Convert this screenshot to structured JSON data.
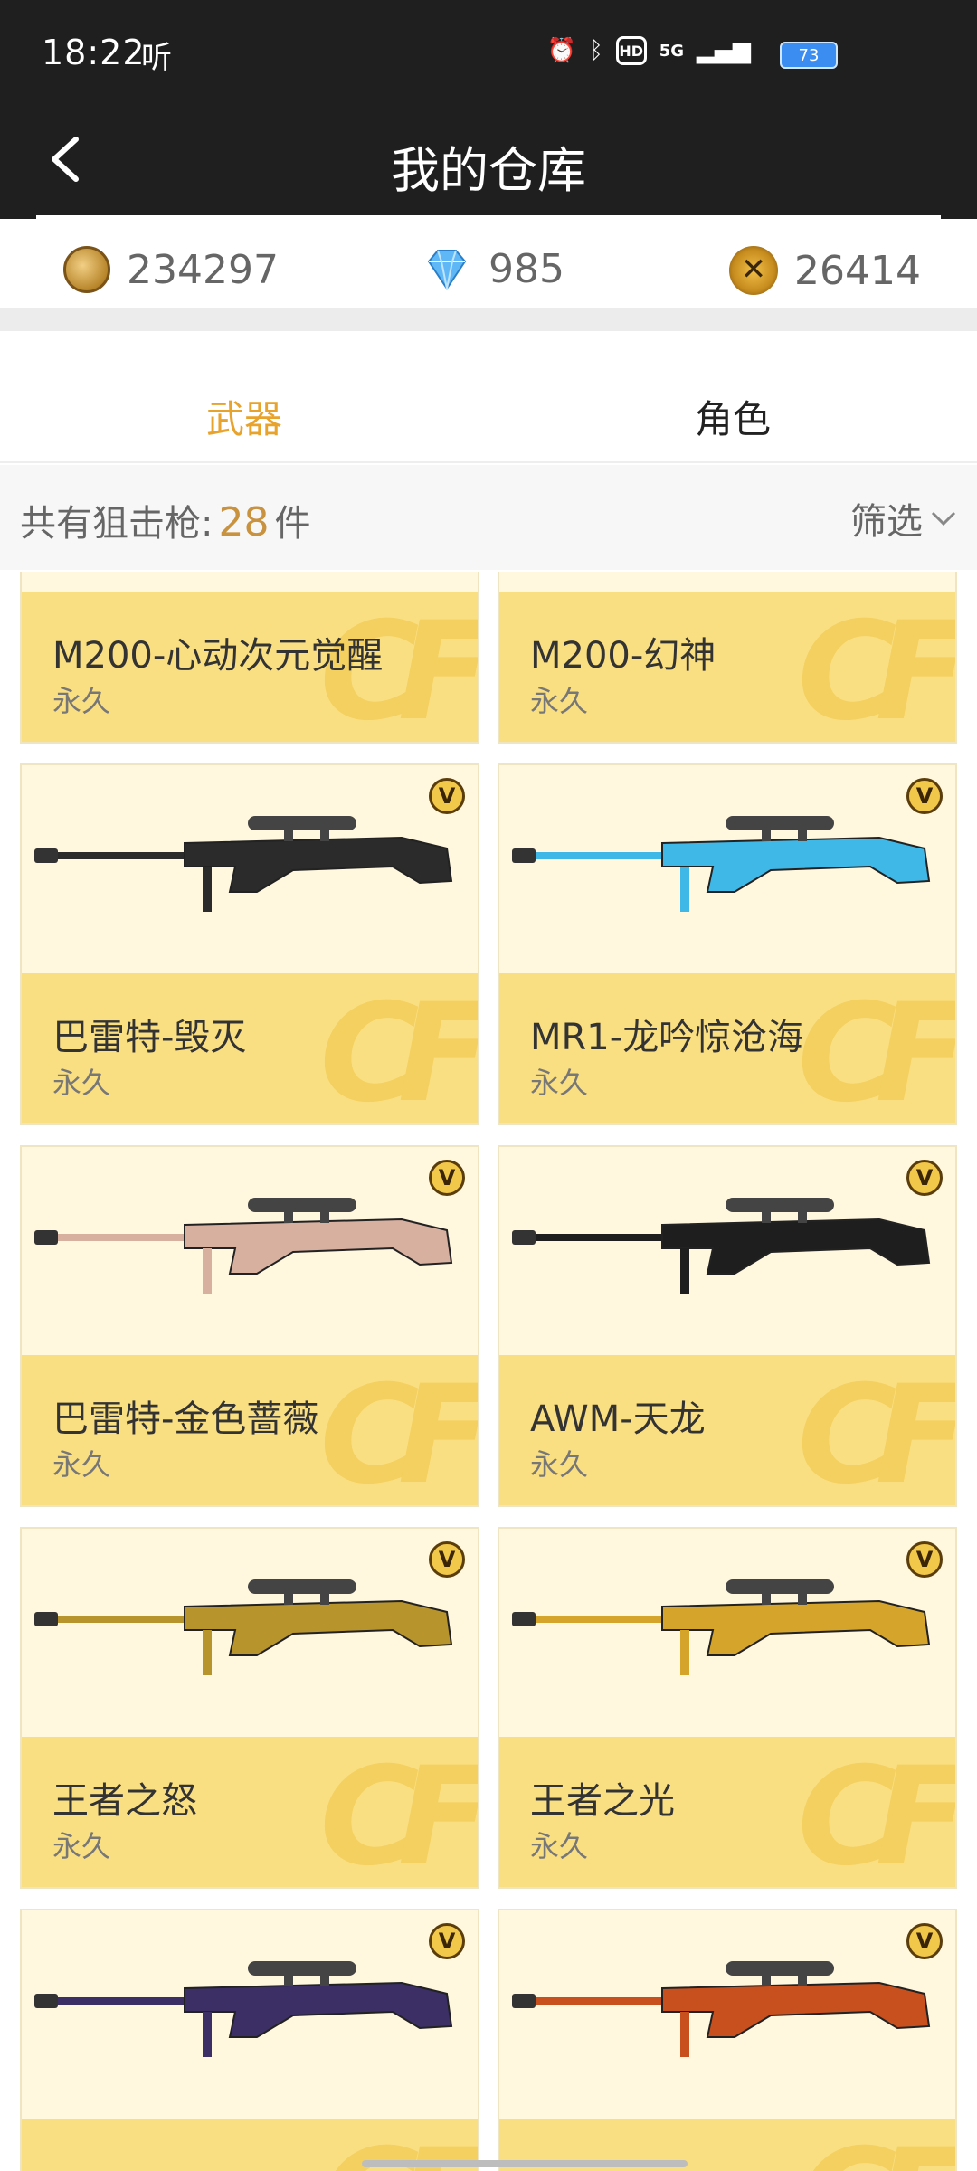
{
  "status": {
    "time": "18:22",
    "extra": "听",
    "network": "5G",
    "battery": "73"
  },
  "header": {
    "title": "我的仓库"
  },
  "currencies": [
    {
      "icon": "coin-icon",
      "value": "234297"
    },
    {
      "icon": "diamond-icon",
      "value": "985"
    },
    {
      "icon": "medal-icon",
      "value": "26414"
    }
  ],
  "tabs": [
    {
      "label": "武器",
      "active": true
    },
    {
      "label": "角色",
      "active": false
    }
  ],
  "list": {
    "count_prefix": "共有狙击枪:",
    "count": "28",
    "count_suffix": "件",
    "filter_label": "筛选"
  },
  "cf_mark": "CF",
  "items": [
    {
      "name": "M200-心动次元觉醒",
      "duration": "永久",
      "badge": "",
      "gun_color": "#e56bb0"
    },
    {
      "name": "M200-幻神",
      "duration": "永久",
      "badge": "",
      "gun_color": "#3a3a30"
    },
    {
      "name": "巴雷特-毁灭",
      "duration": "永久",
      "badge": "V",
      "gun_color": "#2b2b2b"
    },
    {
      "name": "MR1-龙吟惊沧海",
      "duration": "永久",
      "badge": "V",
      "gun_color": "#3fb8e8"
    },
    {
      "name": "巴雷特-金色蔷薇",
      "duration": "永久",
      "badge": "V",
      "gun_color": "#d8b0a0"
    },
    {
      "name": "AWM-天龙",
      "duration": "永久",
      "badge": "V",
      "gun_color": "#1e1e1e"
    },
    {
      "name": "王者之怒",
      "duration": "永久",
      "badge": "V",
      "gun_color": "#b8942c"
    },
    {
      "name": "王者之光",
      "duration": "永久",
      "badge": "V",
      "gun_color": "#d4a52a"
    },
    {
      "name": "",
      "duration": "",
      "badge": "V",
      "gun_color": "#3b2f66"
    },
    {
      "name": "",
      "duration": "",
      "badge": "V",
      "gun_color": "#c8501e"
    }
  ]
}
